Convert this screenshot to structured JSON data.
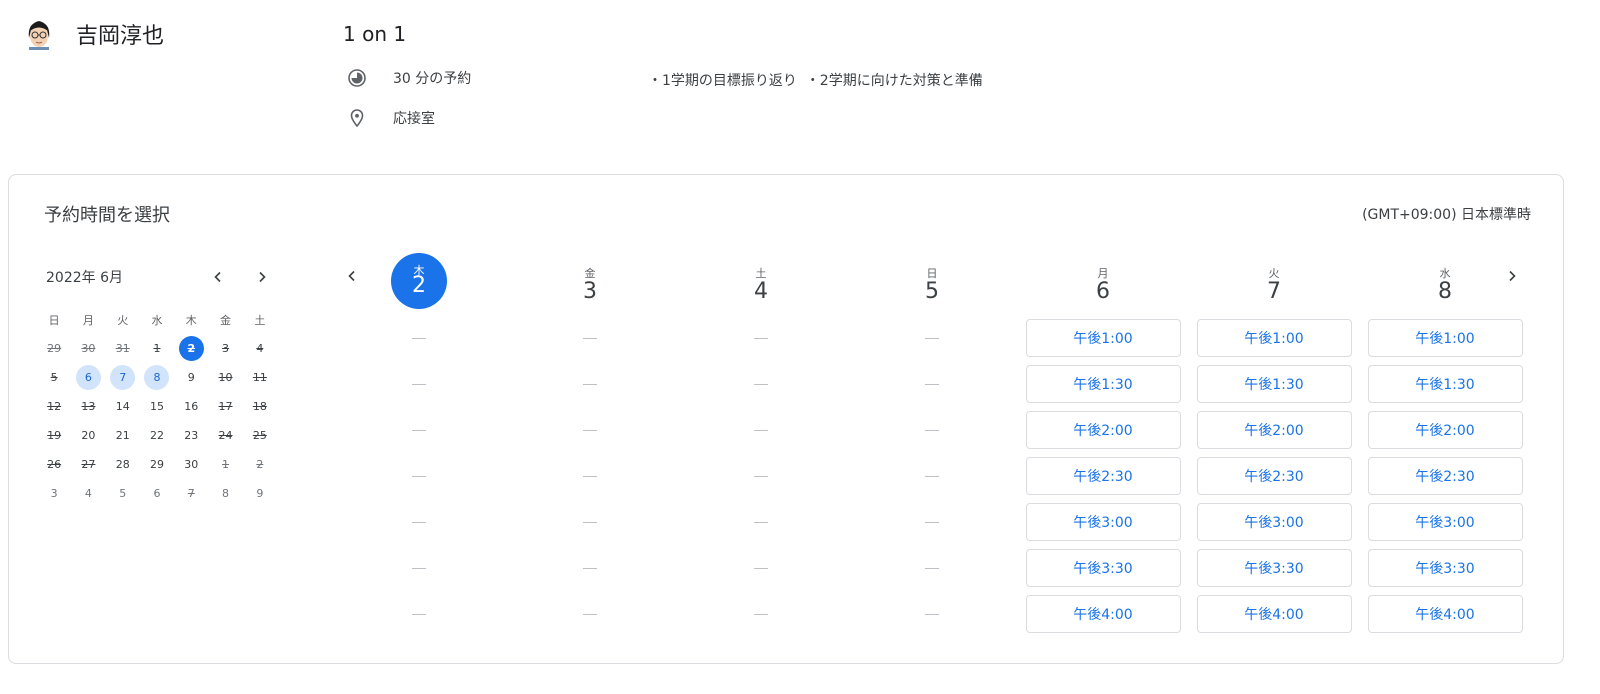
{
  "host": {
    "name": "吉岡淳也"
  },
  "event": {
    "title": "1 on 1",
    "duration": "30 分の予約",
    "location": "応接室",
    "description": "・1学期の目標振り返り  ・2学期に向けた対策と準備"
  },
  "booking": {
    "title": "予約時間を選択",
    "timezone": "(GMT+09:00) 日本標準時"
  },
  "mini_calendar": {
    "month_label": "2022年 6月",
    "weekdays": [
      "日",
      "月",
      "火",
      "水",
      "木",
      "金",
      "土"
    ],
    "weeks": [
      [
        {
          "d": "29",
          "s": "dis-out"
        },
        {
          "d": "30",
          "s": "dis-out"
        },
        {
          "d": "31",
          "s": "dis-out"
        },
        {
          "d": "1",
          "s": "dis"
        },
        {
          "d": "2",
          "s": "sel"
        },
        {
          "d": "3",
          "s": "dis"
        },
        {
          "d": "4",
          "s": "dis"
        }
      ],
      [
        {
          "d": "5",
          "s": "dis"
        },
        {
          "d": "6",
          "s": "avail"
        },
        {
          "d": "7",
          "s": "avail"
        },
        {
          "d": "8",
          "s": "avail"
        },
        {
          "d": "9",
          "s": "normal"
        },
        {
          "d": "10",
          "s": "dis"
        },
        {
          "d": "11",
          "s": "dis"
        }
      ],
      [
        {
          "d": "12",
          "s": "dis"
        },
        {
          "d": "13",
          "s": "dis"
        },
        {
          "d": "14",
          "s": "normal"
        },
        {
          "d": "15",
          "s": "normal"
        },
        {
          "d": "16",
          "s": "normal"
        },
        {
          "d": "17",
          "s": "dis"
        },
        {
          "d": "18",
          "s": "dis"
        }
      ],
      [
        {
          "d": "19",
          "s": "dis"
        },
        {
          "d": "20",
          "s": "normal"
        },
        {
          "d": "21",
          "s": "normal"
        },
        {
          "d": "22",
          "s": "normal"
        },
        {
          "d": "23",
          "s": "normal"
        },
        {
          "d": "24",
          "s": "dis"
        },
        {
          "d": "25",
          "s": "dis"
        }
      ],
      [
        {
          "d": "26",
          "s": "dis"
        },
        {
          "d": "27",
          "s": "dis"
        },
        {
          "d": "28",
          "s": "normal"
        },
        {
          "d": "29",
          "s": "normal"
        },
        {
          "d": "30",
          "s": "normal"
        },
        {
          "d": "1",
          "s": "dis-out"
        },
        {
          "d": "2",
          "s": "dis-out"
        }
      ],
      [
        {
          "d": "3",
          "s": "out"
        },
        {
          "d": "4",
          "s": "out"
        },
        {
          "d": "5",
          "s": "out"
        },
        {
          "d": "6",
          "s": "out"
        },
        {
          "d": "7",
          "s": "dis-out"
        },
        {
          "d": "8",
          "s": "out"
        },
        {
          "d": "9",
          "s": "out"
        }
      ]
    ]
  },
  "week": {
    "days": [
      {
        "dow": "木",
        "num": "2",
        "today": true,
        "slots": []
      },
      {
        "dow": "金",
        "num": "3",
        "today": false,
        "slots": []
      },
      {
        "dow": "土",
        "num": "4",
        "today": false,
        "slots": []
      },
      {
        "dow": "日",
        "num": "5",
        "today": false,
        "slots": []
      },
      {
        "dow": "月",
        "num": "6",
        "today": false,
        "slots": [
          "午後1:00",
          "午後1:30",
          "午後2:00",
          "午後2:30",
          "午後3:00",
          "午後3:30",
          "午後4:00"
        ]
      },
      {
        "dow": "火",
        "num": "7",
        "today": false,
        "slots": [
          "午後1:00",
          "午後1:30",
          "午後2:00",
          "午後2:30",
          "午後3:00",
          "午後3:30",
          "午後4:00"
        ]
      },
      {
        "dow": "水",
        "num": "8",
        "today": false,
        "slots": [
          "午後1:00",
          "午後1:30",
          "午後2:00",
          "午後2:30",
          "午後3:00",
          "午後3:30",
          "午後4:00"
        ]
      }
    ]
  }
}
